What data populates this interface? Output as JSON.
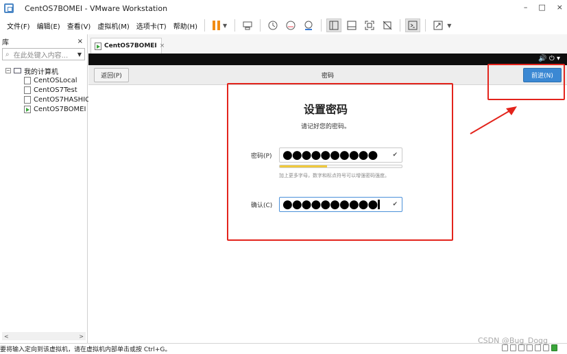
{
  "window": {
    "title": "CentOS7BOMEI - VMware Workstation",
    "minimize": "–",
    "maximize": "□",
    "close": "×"
  },
  "menu": {
    "items": [
      "文件(F)",
      "编辑(E)",
      "查看(V)",
      "虚拟机(M)",
      "选项卡(T)",
      "帮助(H)"
    ]
  },
  "library": {
    "title": "库",
    "close": "×",
    "search_placeholder": "在此处键入内容...",
    "root": "我的计算机",
    "vms": [
      "CentOSLocal",
      "CentOS7Test",
      "CentOS7HASHIC",
      "CentOS7BOMEI"
    ],
    "running_vm": "CentOS7BOMEI",
    "scroll_left": "<",
    "scroll_right": ">"
  },
  "tab": {
    "label": "CentOS7BOMEI",
    "close": "×"
  },
  "vm_screen": {
    "back_button": "返回(P)",
    "page_heading": "密码",
    "next_button": "前进(N)",
    "title": "设置密码",
    "subtitle": "请记好您的密码。",
    "password_label": "密码(P)",
    "password_value": "●●●●●●●●●●",
    "confirm_label": "确认(C)",
    "confirm_value": "●●●●●●●●●●",
    "check_mark": "✔",
    "strength_fraction": 0.39,
    "hint": "加上更多字母，数字和标点符号可以增强密码强度。",
    "topbar_icons": "🔊 ⏻ ▾"
  },
  "status": {
    "text": "要将输入定向到该虚拟机，请在虚拟机内部单击或按 Ctrl+G。"
  },
  "watermark": "CSDN @Bug_Dogg",
  "colors": {
    "annotation_red": "#e3231b",
    "next_button_blue": "#3b88d3",
    "pause_orange": "#f28c13"
  }
}
